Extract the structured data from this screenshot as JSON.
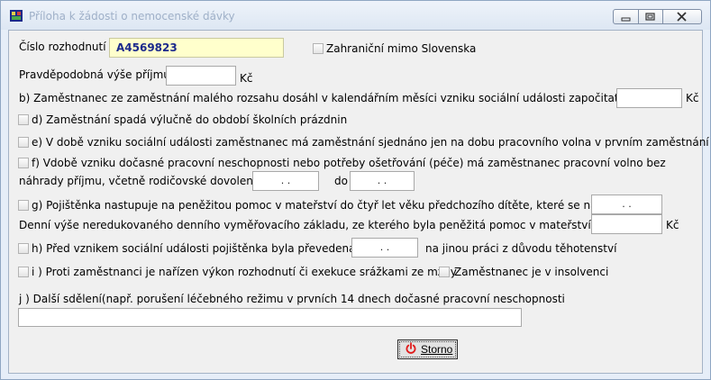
{
  "window": {
    "title": "Příloha k žádosti o nemocenské dávky"
  },
  "form": {
    "cislo_rozhodnuti_label": "Číslo rozhodnutí",
    "cislo_rozhodnuti_value": "A4569823",
    "zahranicni_label": "Zahraniční mimo Slovenska",
    "pravdepodobna_label": "Pravděpodobná výše příjmu",
    "pravdepodobna_value": "",
    "currency": "Kč",
    "b_label": "b) Zaměstnanec ze zaměstnání malého rozsahu dosáhl v kalendářním měsíci vzniku sociální události započitatelný příjem",
    "b_value": "",
    "d_label": "d) Zaměstnání spadá výlučně do období školních prázdnin",
    "e_label": "e) V době vzniku sociální události zaměstnanec má zaměstnání sjednáno jen na dobu pracovního volna v prvním zaměstnání",
    "f_label_1": "f) Vdobě vzniku dočasné pracovní neschopnosti nebo potřeby ošetřování (péče) má zaměstnanec pracovní volno bez",
    "f_label_2": "náhrady příjmu, včetně rodičovské dovolené od",
    "f_from_value": ". .",
    "f_to_label": "do",
    "f_to_value": ". .",
    "g_label_1": "g) Pojištěnka nastupuje na peněžitou pomoc v mateřství do čtyř let věku předchozího dítěte, které se narodilo dne",
    "g_date_value": ". .",
    "g_label_2": "Denní výše neredukovaného denního vyměřovacího základu, ze kterého byla peněžitá pomoc v mateřství stanovena",
    "g_amount_value": "",
    "h_label": "h) Před vznikem sociální události pojištěnka byla převedena dne",
    "h_date_value": ". .",
    "h_label_2": "na jinou práci z důvodu těhotenství",
    "i_label": "i ) Proti zaměstnanci je nařízen výkon rozhodnutí či exekuce srážkami ze mzdy",
    "insolvence_label": "Zaměstnanec je v insolvenci",
    "j_label": "j ) Další sdělení(např. porušení léčebného režimu v prvních 14 dnech dočasné pracovní neschopnosti",
    "j_value": "",
    "storno_label": "Storno"
  }
}
